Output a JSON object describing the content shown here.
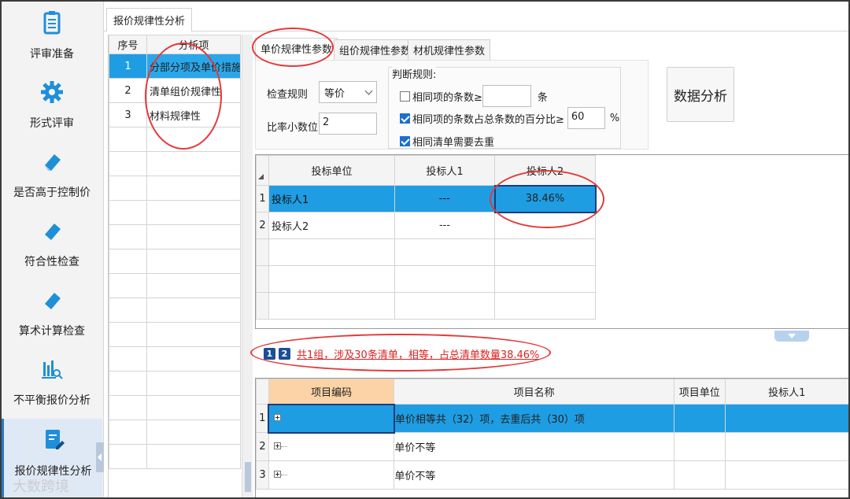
{
  "sidebar": {
    "items": [
      {
        "label": "评审准备",
        "icon": "clipboard-icon"
      },
      {
        "label": "形式评审",
        "icon": "gear-icon"
      },
      {
        "label": "是否高于控制价",
        "icon": "eraser-icon"
      },
      {
        "label": "符合性检查",
        "icon": "eraser-icon"
      },
      {
        "label": "算术计算检查",
        "icon": "eraser-icon"
      },
      {
        "label": "不平衡报价分析",
        "icon": "bar-chart-search-icon"
      },
      {
        "label": "报价规律性分析",
        "icon": "document-edit-icon"
      }
    ],
    "active_index": 6
  },
  "main_tab": {
    "label": "报价规律性分析"
  },
  "left_grid": {
    "headers": {
      "num": "序号",
      "name": "分析项"
    },
    "rows": [
      {
        "num": "1",
        "name": "分部分项及单价措施规"
      },
      {
        "num": "2",
        "name": "清单组价规律性"
      },
      {
        "num": "3",
        "name": "材料规律性"
      }
    ]
  },
  "sub_tabs": [
    {
      "label": "单价规律性参数"
    },
    {
      "label": "组价规律性参数"
    },
    {
      "label": "材机规律性参数"
    }
  ],
  "params": {
    "check_rule_label": "检查规则",
    "check_rule_value": "等价",
    "ratio_decimal_label": "比率小数位",
    "ratio_decimal_value": "2",
    "judgement_title": "判断规则:",
    "rule1_label": "相同项的条数≥",
    "rule1_value": "",
    "rule1_unit": "条",
    "rule1_checked": false,
    "rule2_label": "相同项的条数占总条数的百分比≥",
    "rule2_value": "60",
    "rule2_unit": "%",
    "rule2_checked": true,
    "rule3_label": "相同清单需要去重",
    "rule3_checked": true
  },
  "analyze_button": {
    "label": "数据分析"
  },
  "upper_grid": {
    "headers": [
      "投标单位",
      "投标人1",
      "投标人2"
    ],
    "rows": [
      {
        "num": "1",
        "unit": "投标人1",
        "b1": "---",
        "b2": "38.46%"
      },
      {
        "num": "2",
        "unit": "投标人2",
        "b1": "---",
        "b2": ""
      }
    ]
  },
  "pager": {
    "pages": [
      "1",
      "2"
    ],
    "summary": "共1组，涉及30条清单，相等，占总清单数量38.46%"
  },
  "lower_grid": {
    "headers": [
      "项目编码",
      "项目名称",
      "项目单位",
      "投标人1"
    ],
    "rows": [
      {
        "num": "1",
        "name": "单价相等共（32）项，去重后共（30）项"
      },
      {
        "num": "2",
        "name": "单价不等"
      },
      {
        "num": "3",
        "name": "单价不等"
      }
    ]
  },
  "watermark": "大数跨境",
  "colors": {
    "selection": "#1f9de3",
    "annotation": "#e33a3a",
    "link_red": "#e02020"
  }
}
